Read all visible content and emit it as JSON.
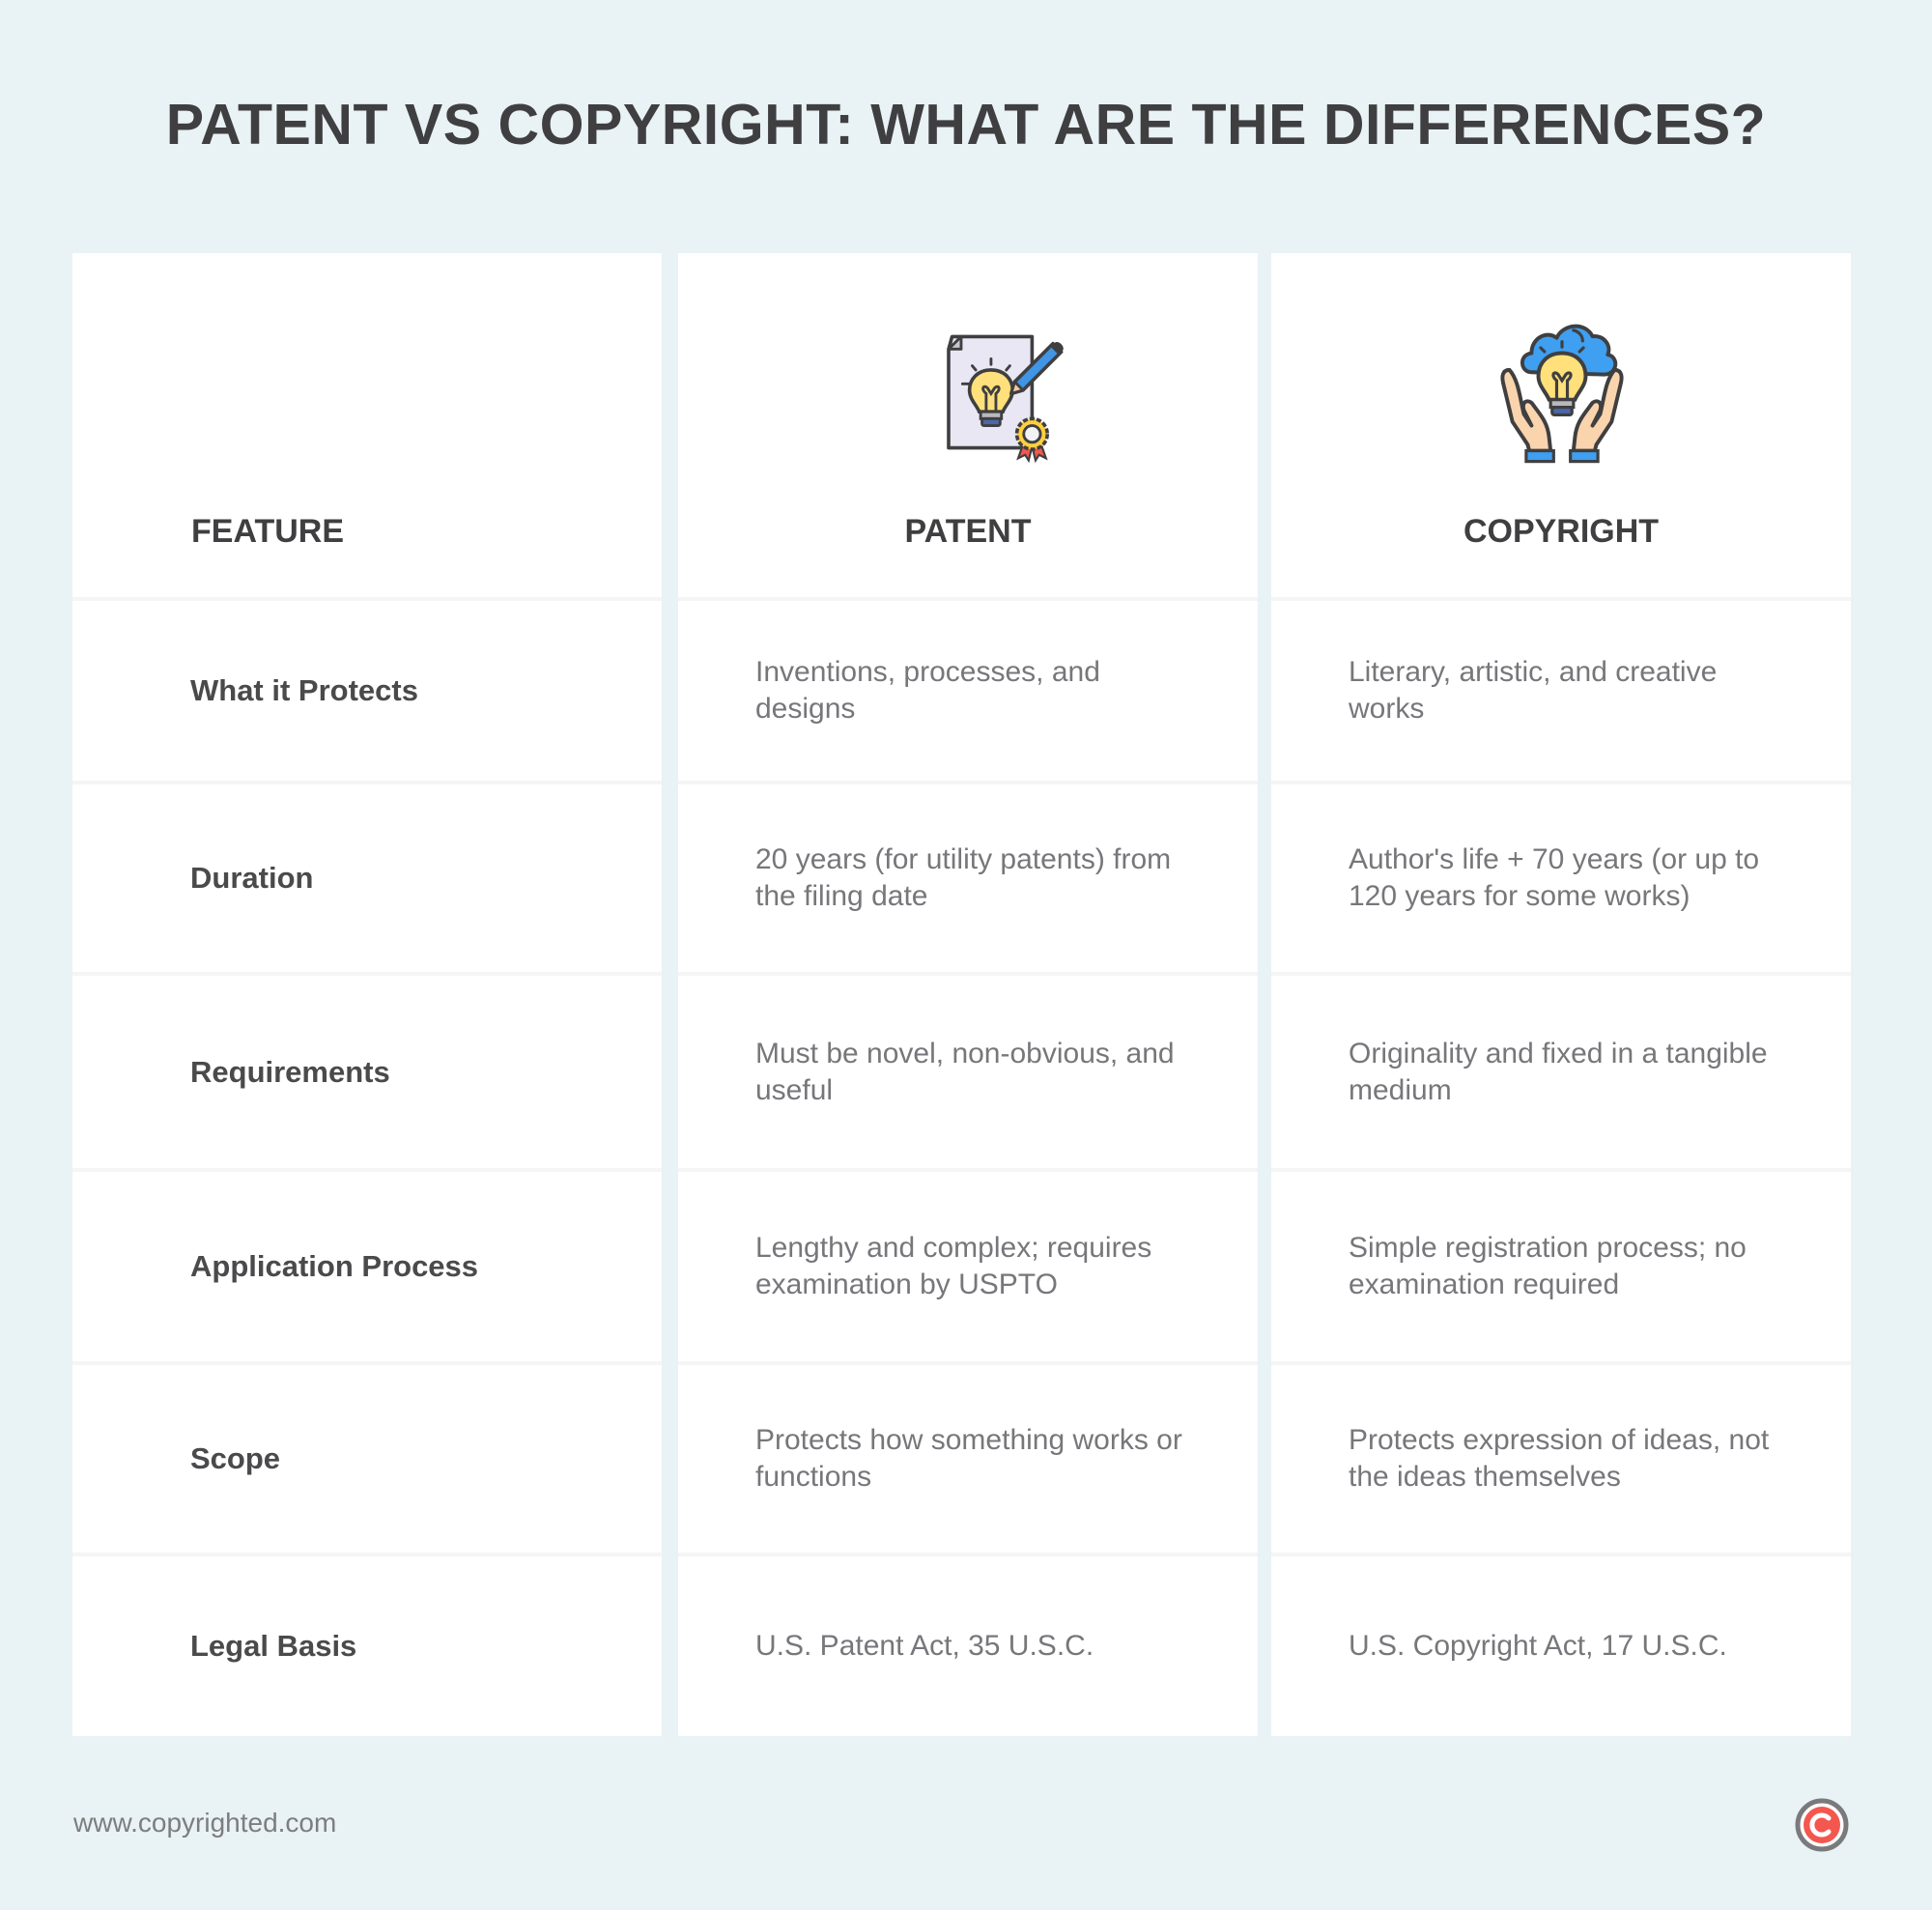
{
  "title": "PATENT VS COPYRIGHT: WHAT ARE THE DIFFERENCES?",
  "table": {
    "headers": {
      "feature": "FEATURE",
      "patent": "PATENT",
      "copyright": "COPYRIGHT"
    },
    "header_icons": {
      "patent": "patent-document-lightbulb-icon",
      "copyright": "hands-lightbulb-cloud-icon"
    },
    "rows": [
      {
        "feature": "What it Protects",
        "patent": "Inventions, processes, and designs",
        "copyright": "Literary, artistic, and creative works"
      },
      {
        "feature": "Duration",
        "patent": "20 years (for utility patents) from the filing date",
        "copyright": "Author's life + 70 years (or up to 120 years for some works)"
      },
      {
        "feature": "Requirements",
        "patent": "Must be novel, non-obvious, and useful",
        "copyright": "Originality and fixed in a tangible medium"
      },
      {
        "feature": "Application Process",
        "patent": "Lengthy and complex; requires examination by USPTO",
        "copyright": "Simple registration process; no examination required"
      },
      {
        "feature": "Scope",
        "patent": "Protects how something works or functions",
        "copyright": "Protects expression of ideas, not the ideas themselves"
      },
      {
        "feature": "Legal Basis",
        "patent": "U.S. Patent Act, 35 U.S.C.",
        "copyright": "U.S. Copyright Act, 17 U.S.C."
      }
    ]
  },
  "footer": {
    "url": "www.copyrighted.com",
    "logo_icon": "copyright-logo-icon"
  },
  "colors": {
    "background": "#e9f2f4",
    "accent_red": "#f4574f",
    "logo_ring": "#7a7a7d",
    "text_dark": "#3f3f41",
    "text_muted": "#77777b"
  }
}
